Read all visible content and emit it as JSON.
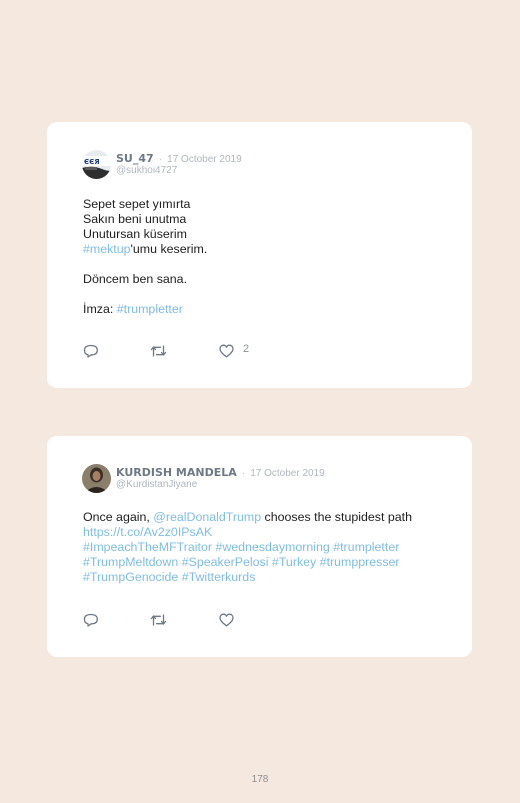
{
  "tweets": [
    {
      "name": "SU_47",
      "date": "17 October 2019",
      "handle": "@sukhoi4727",
      "lines": [
        "Sepet sepet yımırta",
        "Sakın beni unutma",
        "Unutursan küserim"
      ],
      "hashtag_line": {
        "tag": "#mektup",
        "rest": "'umu keserim."
      },
      "line_after": "Döncem ben sana.",
      "signature": {
        "prefix": "İmza: ",
        "tag": "#trumpletter"
      },
      "likes": "2",
      "avatar_text": "ЄЄЯ"
    },
    {
      "name": "KURDISH MANDELA",
      "date": "17 October 2019",
      "handle": "@KurdistanJiyane",
      "text_before": "Once again, ",
      "mention": "@realDonaldTrump",
      "text_after": " chooses the stupidest path",
      "url": "https://t.co/Av2z0IPsAK",
      "hashtag_lines": [
        "#ImpeachTheMFTraitor #wednesdaymorning #trumpletter",
        "#TrumpMeltdown #SpeakerPelosi #Turkey #trumppresser",
        "#TrumpGenocide #Twitterkurds"
      ]
    }
  ],
  "separator": "·",
  "icons": [
    "reply-icon",
    "retweet-icon",
    "like-icon"
  ],
  "page_number": "178",
  "colors": {
    "background": "#f4e8df",
    "card": "#ffffff",
    "link": "#7fbde3",
    "name": "#6e7985",
    "meta": "#b0b7be"
  }
}
